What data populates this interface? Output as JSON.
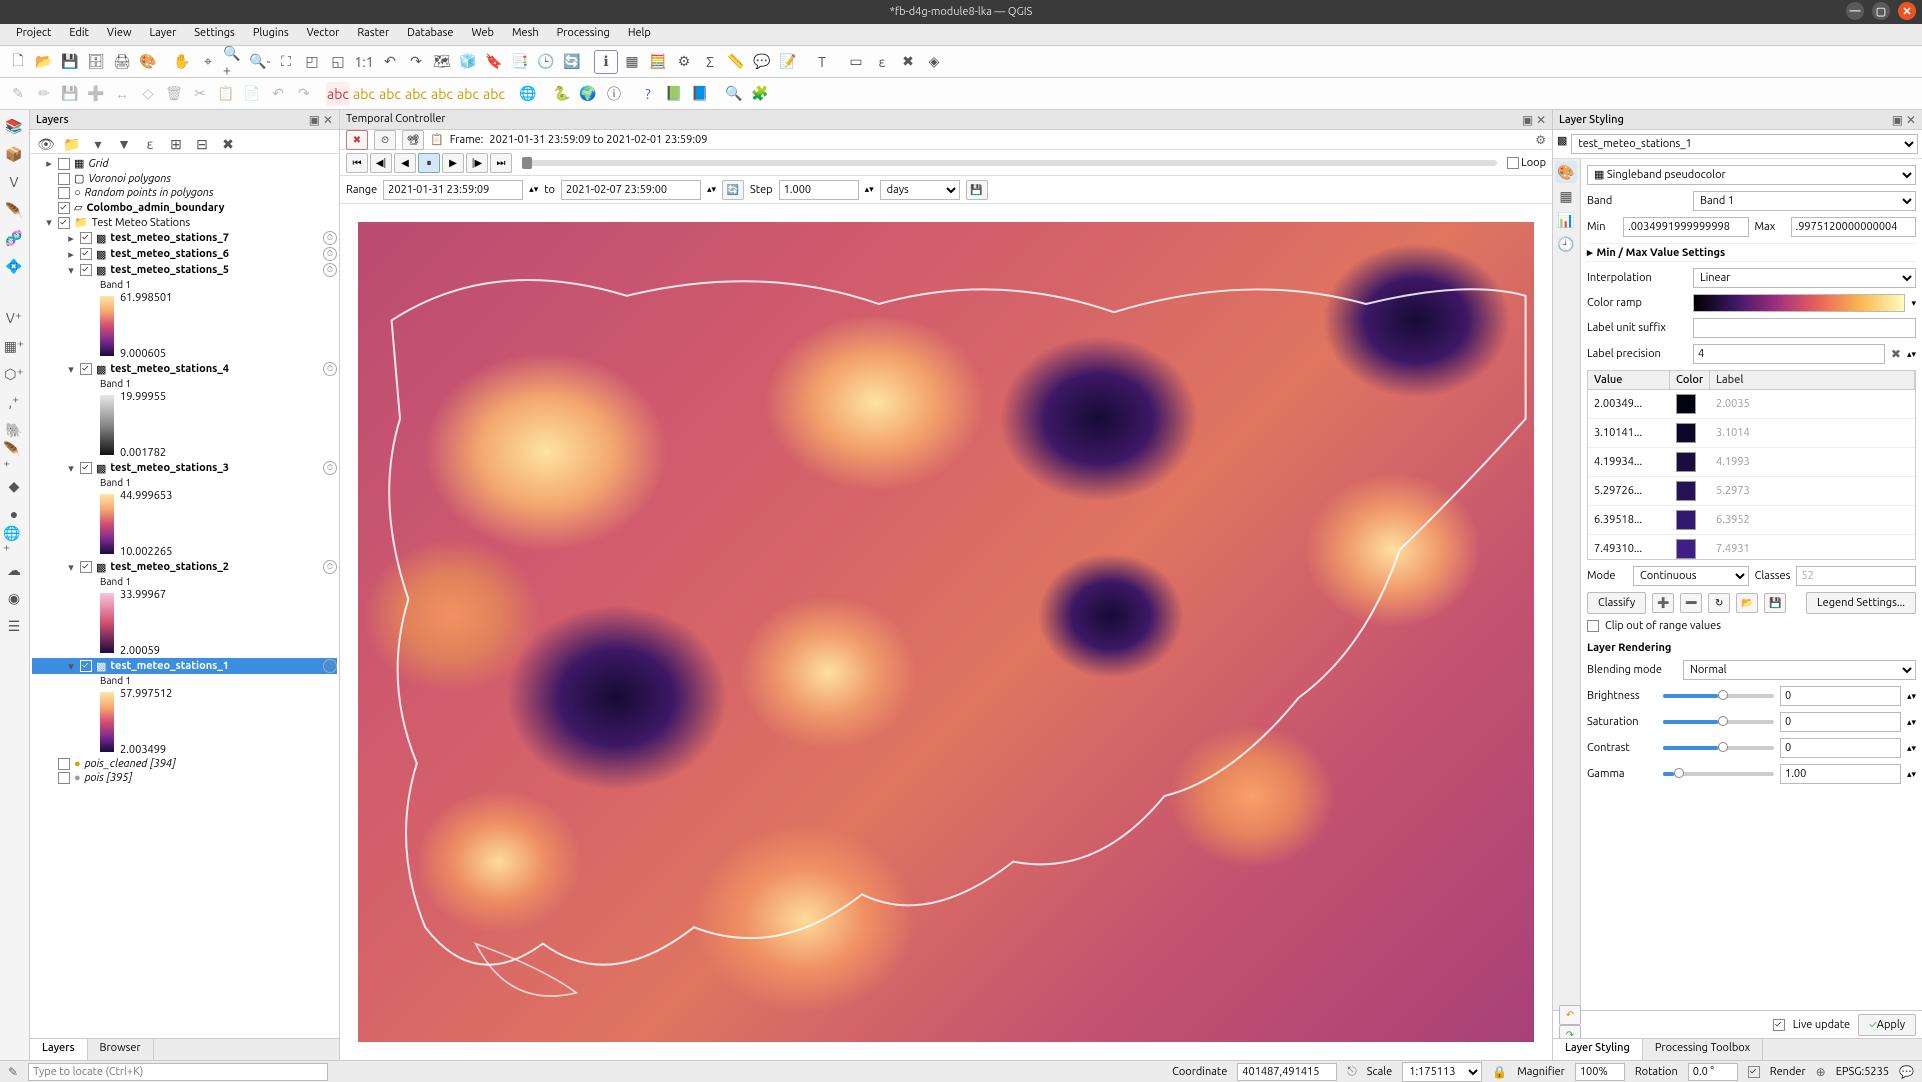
{
  "window": {
    "title": "*fb-d4g-module8-lka — QGIS"
  },
  "menu": {
    "items": [
      "Project",
      "Edit",
      "View",
      "Layer",
      "Settings",
      "Plugins",
      "Vector",
      "Raster",
      "Database",
      "Web",
      "Mesh",
      "Processing",
      "Help"
    ]
  },
  "panels": {
    "layers_title": "Layers",
    "temporal_title": "Temporal Controller",
    "styling_title": "Layer Styling",
    "browser_tab": "Browser",
    "layers_tab": "Layers",
    "styling_tab": "Layer Styling",
    "toolbox_tab": "Processing Toolbox"
  },
  "temporal": {
    "frame_label": "Frame:",
    "frame_text": "2021-01-31 23:59:09 to 2021-02-01 23:59:09",
    "loop": "Loop",
    "range_label": "Range",
    "range_from": "2021-01-31 23:59:09",
    "to": "to",
    "range_to": "2021-02-07 23:59:00",
    "step_label": "Step",
    "step_value": "1.000",
    "step_unit": "days"
  },
  "layers": {
    "items": [
      {
        "name": "Grid",
        "italic": true,
        "checked": false
      },
      {
        "name": "Voronoi polygons",
        "italic": true,
        "checked": false
      },
      {
        "name": "Random points in polygons",
        "italic": true,
        "checked": false
      },
      {
        "name": "Colombo_admin_boundary",
        "bold": true,
        "checked": true
      },
      {
        "name": "Test Meteo Stations",
        "checked": true,
        "group": true
      }
    ],
    "sublayers": [
      {
        "name": "test_meteo_stations_7",
        "bold": true,
        "checked": true
      },
      {
        "name": "test_meteo_stations_6",
        "bold": true,
        "checked": true
      },
      {
        "name": "test_meteo_stations_5",
        "bold": true,
        "checked": true,
        "band": "Band 1",
        "max": "61.998501",
        "min": "9.000605"
      },
      {
        "name": "test_meteo_stations_4",
        "bold": true,
        "checked": true,
        "band": "Band 1",
        "max": "19.99955",
        "min": "0.001782"
      },
      {
        "name": "test_meteo_stations_3",
        "bold": true,
        "checked": true,
        "band": "Band 1",
        "max": "44.999653",
        "min": "10.002265"
      },
      {
        "name": "test_meteo_stations_2",
        "bold": true,
        "checked": true,
        "band": "Band 1",
        "max": "33.99967",
        "min": "2.00059"
      },
      {
        "name": "test_meteo_stations_1",
        "bold": true,
        "checked": true,
        "selected": true,
        "band": "Band 1",
        "max": "57.997512",
        "min": "2.003499"
      }
    ],
    "pois1": "pois_cleaned [394]",
    "pois2": "pois [395]"
  },
  "styling": {
    "current_layer": "test_meteo_stations_1",
    "render_type": "Singleband pseudocolor",
    "band_label": "Band",
    "band_value": "Band 1",
    "min_label": "Min",
    "min_value": ".0034991999999998",
    "max_label": "Max",
    "max_value": ".9975120000000004",
    "minmax_header": "Min / Max Value Settings",
    "interpolation_label": "Interpolation",
    "interpolation_value": "Linear",
    "colorramp_label": "Color ramp",
    "suffix_label": "Label unit suffix",
    "precision_label": "Label precision",
    "precision_value": "4",
    "table_headers": {
      "value": "Value",
      "color": "Color",
      "label": "Label"
    },
    "classes": [
      {
        "value": "2.00349...",
        "color": "#03040f",
        "label": "2.0035"
      },
      {
        "value": "3.10141...",
        "color": "#0d0829",
        "label": "3.1014"
      },
      {
        "value": "4.19934...",
        "color": "#1a0d40",
        "label": "4.1993"
      },
      {
        "value": "5.29726...",
        "color": "#261257",
        "label": "5.2973"
      },
      {
        "value": "6.39518...",
        "color": "#32186f",
        "label": "6.3952"
      },
      {
        "value": "7.49310...",
        "color": "#3f1e85",
        "label": "7.4931"
      }
    ],
    "mode_label": "Mode",
    "mode_value": "Continuous",
    "classes_label": "Classes",
    "classes_value": "52",
    "classify_btn": "Classify",
    "legend_btn": "Legend Settings...",
    "clip_label": "Clip out of range values",
    "rendering_header": "Layer Rendering",
    "blending_label": "Blending mode",
    "blending_value": "Normal",
    "brightness_label": "Brightness",
    "brightness_value": "0",
    "saturation_label": "Saturation",
    "saturation_value": "0",
    "contrast_label": "Contrast",
    "contrast_value": "0",
    "gamma_label": "Gamma",
    "gamma_value": "1.00",
    "live_update": "Live update",
    "apply": "Apply"
  },
  "status": {
    "locator_placeholder": "Type to locate (Ctrl+K)",
    "coord_label": "Coordinate",
    "coord_value": "401487,491415",
    "scale_label": "Scale",
    "scale_value": "1:175113",
    "magnifier_label": "Magnifier",
    "magnifier_value": "100%",
    "rotation_label": "Rotation",
    "rotation_value": "0.0 °",
    "render_label": "Render",
    "crs": "EPSG:5235"
  }
}
